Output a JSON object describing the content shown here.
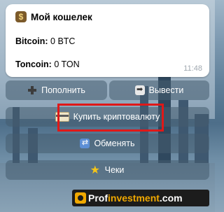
{
  "message": {
    "title": "Мой кошелек",
    "title_icon": "money-bag-icon",
    "bitcoin_label": "Bitcoin:",
    "bitcoin_value": "0 BTC",
    "toncoin_label": "Toncoin:",
    "toncoin_value": "0 TON",
    "time": "11:48"
  },
  "keyboard": {
    "deposit_label": "Пополнить",
    "withdraw_label": "Вывести",
    "buy_label": "Купить криптовалюту",
    "exchange_label": "Обменять",
    "checks_label": "Чеки"
  },
  "watermark": {
    "part1": "Prof",
    "part2": "investment",
    "part3": ".com"
  },
  "colors": {
    "highlight": "#e01818",
    "brand_accent": "#f0a800"
  }
}
